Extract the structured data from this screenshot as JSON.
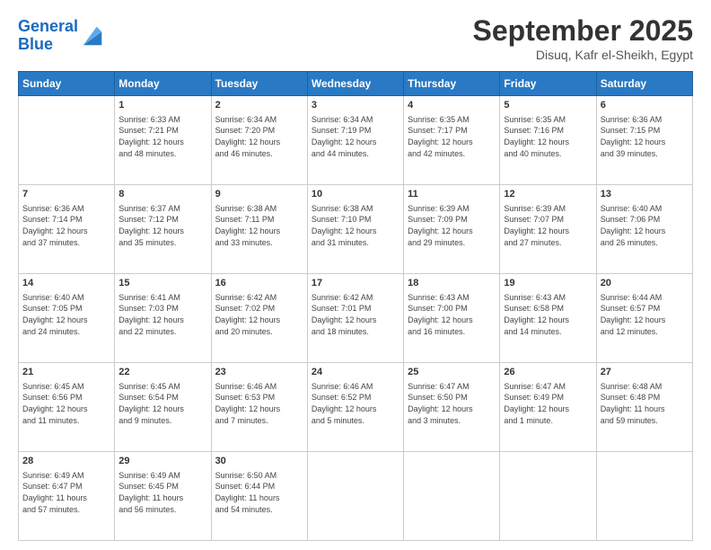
{
  "logo": {
    "line1": "General",
    "line2": "Blue"
  },
  "title": "September 2025",
  "subtitle": "Disuq, Kafr el-Sheikh, Egypt",
  "days_header": [
    "Sunday",
    "Monday",
    "Tuesday",
    "Wednesday",
    "Thursday",
    "Friday",
    "Saturday"
  ],
  "weeks": [
    [
      {
        "day": "",
        "content": ""
      },
      {
        "day": "1",
        "content": "Sunrise: 6:33 AM\nSunset: 7:21 PM\nDaylight: 12 hours\nand 48 minutes."
      },
      {
        "day": "2",
        "content": "Sunrise: 6:34 AM\nSunset: 7:20 PM\nDaylight: 12 hours\nand 46 minutes."
      },
      {
        "day": "3",
        "content": "Sunrise: 6:34 AM\nSunset: 7:19 PM\nDaylight: 12 hours\nand 44 minutes."
      },
      {
        "day": "4",
        "content": "Sunrise: 6:35 AM\nSunset: 7:17 PM\nDaylight: 12 hours\nand 42 minutes."
      },
      {
        "day": "5",
        "content": "Sunrise: 6:35 AM\nSunset: 7:16 PM\nDaylight: 12 hours\nand 40 minutes."
      },
      {
        "day": "6",
        "content": "Sunrise: 6:36 AM\nSunset: 7:15 PM\nDaylight: 12 hours\nand 39 minutes."
      }
    ],
    [
      {
        "day": "7",
        "content": "Sunrise: 6:36 AM\nSunset: 7:14 PM\nDaylight: 12 hours\nand 37 minutes."
      },
      {
        "day": "8",
        "content": "Sunrise: 6:37 AM\nSunset: 7:12 PM\nDaylight: 12 hours\nand 35 minutes."
      },
      {
        "day": "9",
        "content": "Sunrise: 6:38 AM\nSunset: 7:11 PM\nDaylight: 12 hours\nand 33 minutes."
      },
      {
        "day": "10",
        "content": "Sunrise: 6:38 AM\nSunset: 7:10 PM\nDaylight: 12 hours\nand 31 minutes."
      },
      {
        "day": "11",
        "content": "Sunrise: 6:39 AM\nSunset: 7:09 PM\nDaylight: 12 hours\nand 29 minutes."
      },
      {
        "day": "12",
        "content": "Sunrise: 6:39 AM\nSunset: 7:07 PM\nDaylight: 12 hours\nand 27 minutes."
      },
      {
        "day": "13",
        "content": "Sunrise: 6:40 AM\nSunset: 7:06 PM\nDaylight: 12 hours\nand 26 minutes."
      }
    ],
    [
      {
        "day": "14",
        "content": "Sunrise: 6:40 AM\nSunset: 7:05 PM\nDaylight: 12 hours\nand 24 minutes."
      },
      {
        "day": "15",
        "content": "Sunrise: 6:41 AM\nSunset: 7:03 PM\nDaylight: 12 hours\nand 22 minutes."
      },
      {
        "day": "16",
        "content": "Sunrise: 6:42 AM\nSunset: 7:02 PM\nDaylight: 12 hours\nand 20 minutes."
      },
      {
        "day": "17",
        "content": "Sunrise: 6:42 AM\nSunset: 7:01 PM\nDaylight: 12 hours\nand 18 minutes."
      },
      {
        "day": "18",
        "content": "Sunrise: 6:43 AM\nSunset: 7:00 PM\nDaylight: 12 hours\nand 16 minutes."
      },
      {
        "day": "19",
        "content": "Sunrise: 6:43 AM\nSunset: 6:58 PM\nDaylight: 12 hours\nand 14 minutes."
      },
      {
        "day": "20",
        "content": "Sunrise: 6:44 AM\nSunset: 6:57 PM\nDaylight: 12 hours\nand 12 minutes."
      }
    ],
    [
      {
        "day": "21",
        "content": "Sunrise: 6:45 AM\nSunset: 6:56 PM\nDaylight: 12 hours\nand 11 minutes."
      },
      {
        "day": "22",
        "content": "Sunrise: 6:45 AM\nSunset: 6:54 PM\nDaylight: 12 hours\nand 9 minutes."
      },
      {
        "day": "23",
        "content": "Sunrise: 6:46 AM\nSunset: 6:53 PM\nDaylight: 12 hours\nand 7 minutes."
      },
      {
        "day": "24",
        "content": "Sunrise: 6:46 AM\nSunset: 6:52 PM\nDaylight: 12 hours\nand 5 minutes."
      },
      {
        "day": "25",
        "content": "Sunrise: 6:47 AM\nSunset: 6:50 PM\nDaylight: 12 hours\nand 3 minutes."
      },
      {
        "day": "26",
        "content": "Sunrise: 6:47 AM\nSunset: 6:49 PM\nDaylight: 12 hours\nand 1 minute."
      },
      {
        "day": "27",
        "content": "Sunrise: 6:48 AM\nSunset: 6:48 PM\nDaylight: 11 hours\nand 59 minutes."
      }
    ],
    [
      {
        "day": "28",
        "content": "Sunrise: 6:49 AM\nSunset: 6:47 PM\nDaylight: 11 hours\nand 57 minutes."
      },
      {
        "day": "29",
        "content": "Sunrise: 6:49 AM\nSunset: 6:45 PM\nDaylight: 11 hours\nand 56 minutes."
      },
      {
        "day": "30",
        "content": "Sunrise: 6:50 AM\nSunset: 6:44 PM\nDaylight: 11 hours\nand 54 minutes."
      },
      {
        "day": "",
        "content": ""
      },
      {
        "day": "",
        "content": ""
      },
      {
        "day": "",
        "content": ""
      },
      {
        "day": "",
        "content": ""
      }
    ]
  ]
}
